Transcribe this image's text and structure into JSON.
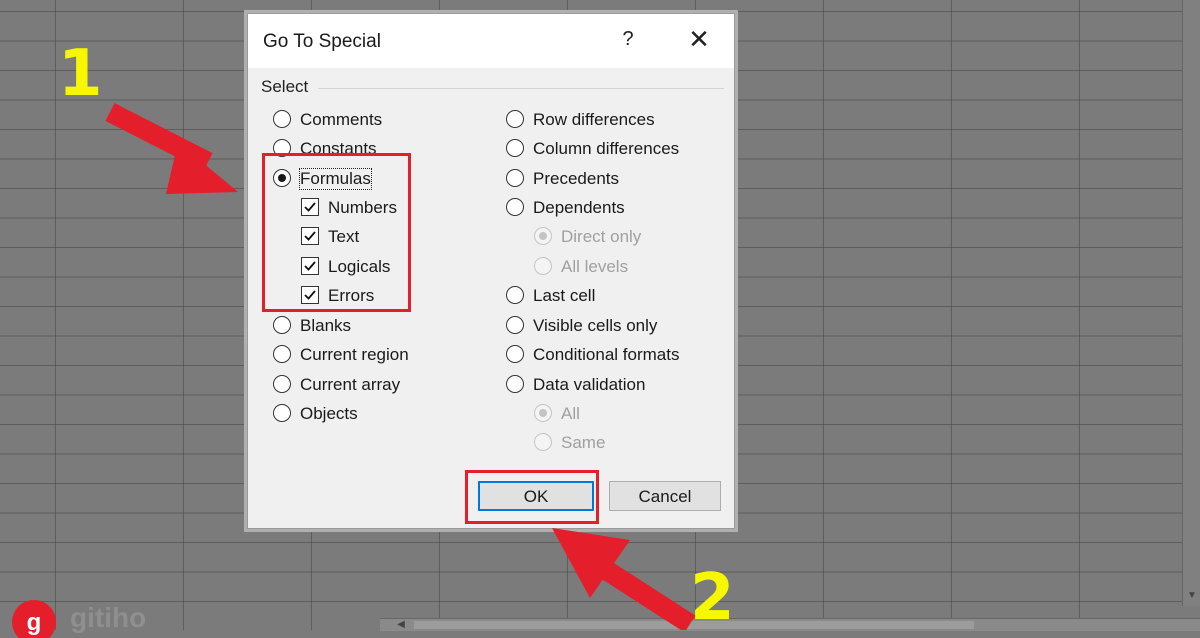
{
  "dialog": {
    "title": "Go To Special",
    "help_label": "?",
    "close_label": "✕",
    "group_label": "Select",
    "left_options": [
      {
        "label": "Comments",
        "selected": false
      },
      {
        "label": "Constants",
        "selected": false
      },
      {
        "label": "Formulas",
        "selected": true
      },
      {
        "label": "Blanks",
        "selected": false
      },
      {
        "label": "Current region",
        "selected": false
      },
      {
        "label": "Current array",
        "selected": false
      },
      {
        "label": "Objects",
        "selected": false
      }
    ],
    "formula_checks": [
      {
        "label": "Numbers",
        "checked": true
      },
      {
        "label": "Text",
        "checked": true
      },
      {
        "label": "Logicals",
        "checked": true
      },
      {
        "label": "Errors",
        "checked": true
      }
    ],
    "right_options": [
      {
        "label": "Row differences",
        "selected": false
      },
      {
        "label": "Column differences",
        "selected": false
      },
      {
        "label": "Precedents",
        "selected": false
      },
      {
        "label": "Dependents",
        "selected": false
      },
      {
        "label": "Last cell",
        "selected": false
      },
      {
        "label": "Visible cells only",
        "selected": false
      },
      {
        "label": "Conditional formats",
        "selected": false
      },
      {
        "label": "Data validation",
        "selected": false
      }
    ],
    "dependents_sub": [
      {
        "label": "Direct only",
        "selected": true,
        "disabled": true
      },
      {
        "label": "All levels",
        "selected": false,
        "disabled": true
      }
    ],
    "validation_sub": [
      {
        "label": "All",
        "selected": true,
        "disabled": true
      },
      {
        "label": "Same",
        "selected": false,
        "disabled": true
      }
    ],
    "ok_label": "OK",
    "cancel_label": "Cancel"
  },
  "annotations": {
    "step1": "1",
    "step2": "2",
    "highlight_color": "#e41e2b",
    "step_color": "#f7f700"
  },
  "watermark": {
    "text": "gitiho"
  },
  "icons": [
    "help-icon",
    "close-icon",
    "checkmark-icon",
    "arrow-icon",
    "gitiho-logo-icon"
  ]
}
